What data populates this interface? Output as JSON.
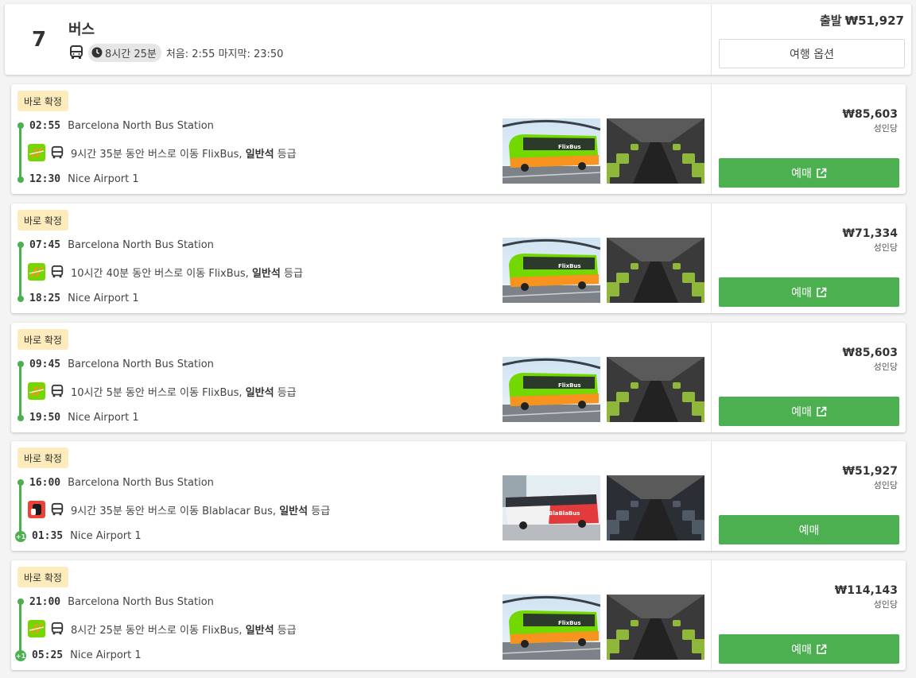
{
  "header": {
    "number": "7",
    "title": "버스",
    "duration": "8시간 25분",
    "first_last": "처음: 2:55 마지막: 23:50",
    "price_label": "출발",
    "price": "₩51,927",
    "options_label": "여행 옵션"
  },
  "trips": [
    {
      "badge": "바로 확정",
      "dep_time": "02:55",
      "dep_station": "Barcelona North Bus Station",
      "arr_time": "12:30",
      "arr_station": "Nice Airport 1",
      "next_day": "",
      "operator_icon": "flixbus-logo-icon",
      "segment_text": "9시간 35분 동안 버스로 이동 FlixBus,",
      "seat_class": "일반석",
      "class_suffix": "등급",
      "price": "₩85,603",
      "per": "성인당",
      "book_label": "예매",
      "external_icon": true
    },
    {
      "badge": "바로 확정",
      "dep_time": "07:45",
      "dep_station": "Barcelona North Bus Station",
      "arr_time": "18:25",
      "arr_station": "Nice Airport 1",
      "next_day": "",
      "operator_icon": "flixbus-logo-icon",
      "segment_text": "10시간 40분 동안 버스로 이동 FlixBus,",
      "seat_class": "일반석",
      "class_suffix": "등급",
      "price": "₩71,334",
      "per": "성인당",
      "book_label": "예매",
      "external_icon": true
    },
    {
      "badge": "바로 확정",
      "dep_time": "09:45",
      "dep_station": "Barcelona North Bus Station",
      "arr_time": "19:50",
      "arr_station": "Nice Airport 1",
      "next_day": "",
      "operator_icon": "flixbus-logo-icon",
      "segment_text": "10시간 5분 동안 버스로 이동 FlixBus,",
      "seat_class": "일반석",
      "class_suffix": "등급",
      "price": "₩85,603",
      "per": "성인당",
      "book_label": "예매",
      "external_icon": true
    },
    {
      "badge": "바로 확정",
      "dep_time": "16:00",
      "dep_station": "Barcelona North Bus Station",
      "arr_time": "01:35",
      "arr_station": "Nice Airport 1",
      "next_day": "+1",
      "operator_icon": "blablacar-logo-icon",
      "segment_text": "9시간 35분 동안 버스로 이동 Blablacar Bus,",
      "seat_class": "일반석",
      "class_suffix": "등급",
      "price": "₩51,927",
      "per": "성인당",
      "book_label": "예매",
      "external_icon": false
    },
    {
      "badge": "바로 확정",
      "dep_time": "21:00",
      "dep_station": "Barcelona North Bus Station",
      "arr_time": "05:25",
      "arr_station": "Nice Airport 1",
      "next_day": "+1",
      "operator_icon": "flixbus-logo-icon",
      "segment_text": "8시간 25분 동안 버스로 이동 FlixBus,",
      "seat_class": "일반석",
      "class_suffix": "등급",
      "price": "₩114,143",
      "per": "성인당",
      "book_label": "예매",
      "external_icon": true
    }
  ],
  "colors": {
    "accent_green": "#4caf50",
    "badge_bg": "#fdebbc",
    "flixbus_green": "#73d700",
    "flixbus_orange": "#f7931e",
    "blablacar_red": "#e8443a"
  }
}
